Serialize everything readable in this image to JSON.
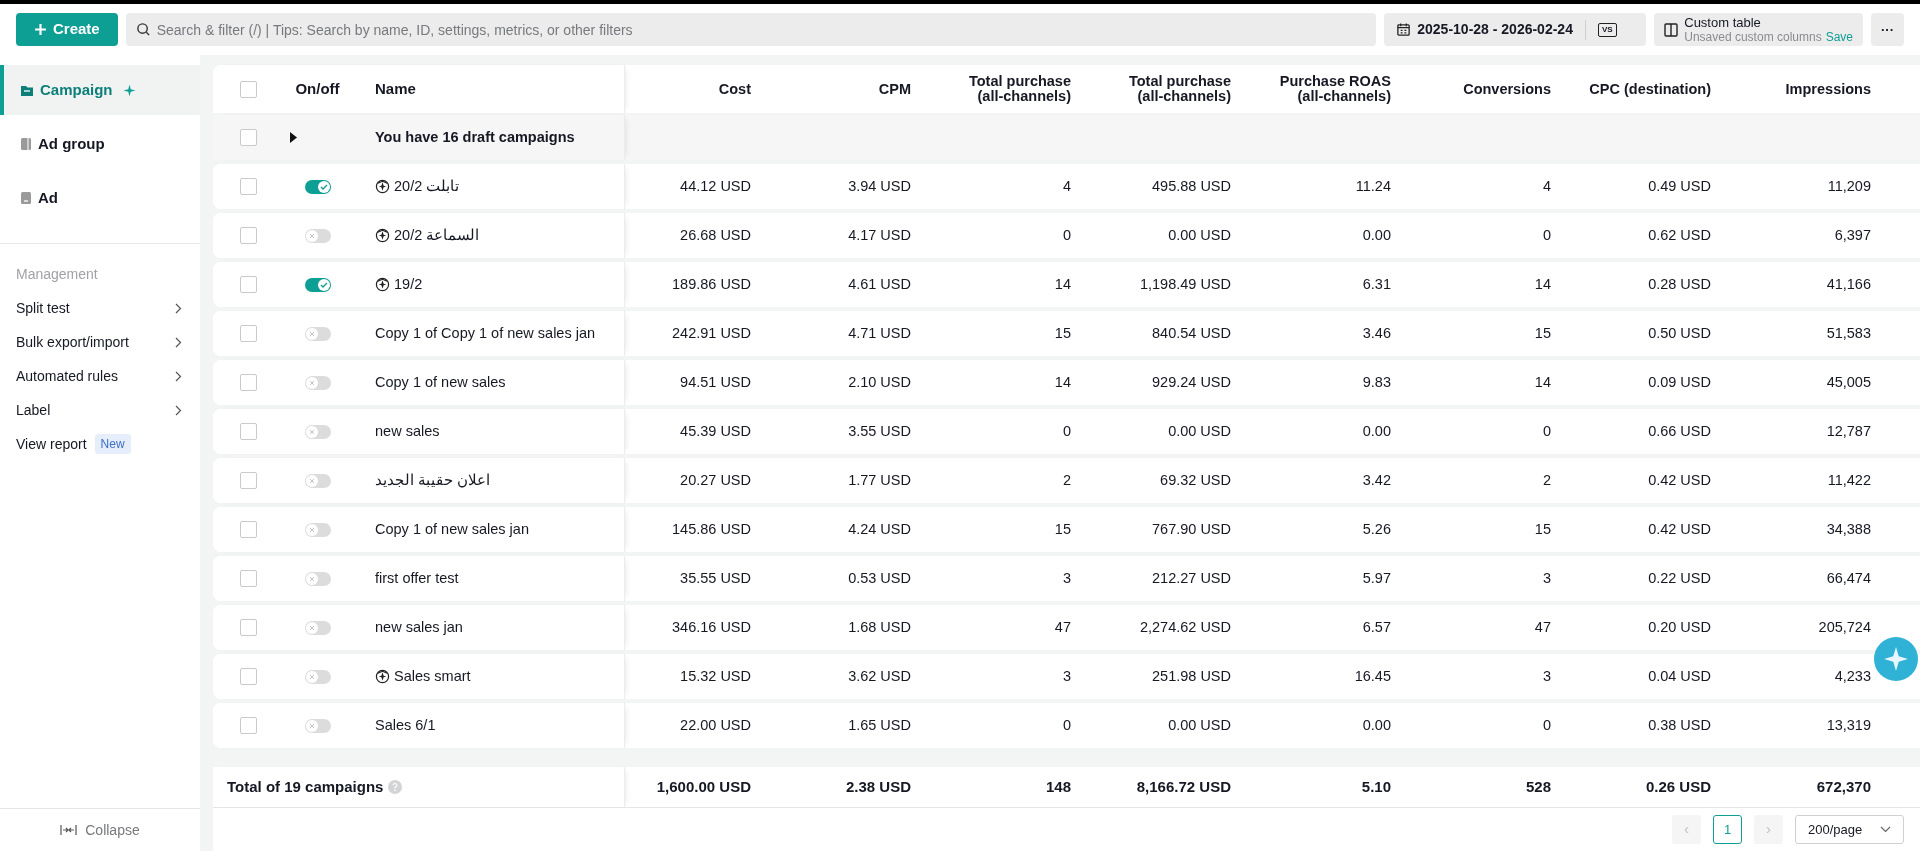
{
  "topbar": {
    "create": "Create",
    "search_placeholder": "Search & filter (/) | Tips: Search by name, ID, settings, metrics, or other filters",
    "date_range": "2025-10-28 - 2026-02-24",
    "compare": "VS",
    "custom_table": {
      "title": "Custom table",
      "subtitle": "Unsaved custom columns",
      "save": "Save"
    },
    "more": "···"
  },
  "sidebar": {
    "levels": [
      {
        "kind": "campaign",
        "label": "Campaign",
        "selected": true
      },
      {
        "kind": "adgroup",
        "label": "Ad group",
        "selected": false
      },
      {
        "kind": "ad",
        "label": "Ad",
        "selected": false
      }
    ],
    "management_title": "Management",
    "management_items": [
      {
        "kind": "submenu",
        "label": "Split test"
      },
      {
        "kind": "submenu",
        "label": "Bulk export/import"
      },
      {
        "kind": "submenu",
        "label": "Automated rules"
      },
      {
        "kind": "submenu",
        "label": "Label"
      },
      {
        "kind": "link",
        "label": "View report",
        "badge": "New"
      }
    ],
    "collapse": "Collapse"
  },
  "table": {
    "header_checked": false,
    "columns": [
      "On/off",
      "Name",
      "Cost",
      "CPM",
      "Total purchase\n(all-channels)",
      "Total purchase\n(all-channels)",
      "Purchase ROAS\n(all-channels)",
      "Conversions",
      "CPC (destination)",
      "Impressions"
    ],
    "draft_row": {
      "checked": false,
      "text": "You have 16 draft campaigns"
    },
    "rows": [
      {
        "checked": false,
        "on": true,
        "smart": true,
        "name": "تابلت 20/2",
        "values": [
          "44.12 USD",
          "3.94 USD",
          "4",
          "495.88 USD",
          "11.24",
          "4",
          "0.49 USD",
          "11,209"
        ]
      },
      {
        "checked": false,
        "on": false,
        "smart": true,
        "name": "السماعة 20/2",
        "values": [
          "26.68 USD",
          "4.17 USD",
          "0",
          "0.00 USD",
          "0.00",
          "0",
          "0.62 USD",
          "6,397"
        ]
      },
      {
        "checked": false,
        "on": true,
        "smart": true,
        "name": "19/2",
        "values": [
          "189.86 USD",
          "4.61 USD",
          "14",
          "1,198.49 USD",
          "6.31",
          "14",
          "0.28 USD",
          "41,166"
        ]
      },
      {
        "checked": false,
        "on": false,
        "smart": false,
        "name": "Copy 1 of Copy 1 of new sales jan",
        "values": [
          "242.91 USD",
          "4.71 USD",
          "15",
          "840.54 USD",
          "3.46",
          "15",
          "0.50 USD",
          "51,583"
        ]
      },
      {
        "checked": false,
        "on": false,
        "smart": false,
        "name": "Copy 1 of new sales",
        "values": [
          "94.51 USD",
          "2.10 USD",
          "14",
          "929.24 USD",
          "9.83",
          "14",
          "0.09 USD",
          "45,005"
        ]
      },
      {
        "checked": false,
        "on": false,
        "smart": false,
        "name": "new sales",
        "values": [
          "45.39 USD",
          "3.55 USD",
          "0",
          "0.00 USD",
          "0.00",
          "0",
          "0.66 USD",
          "12,787"
        ]
      },
      {
        "checked": false,
        "on": false,
        "smart": false,
        "name": "اعلان حقيبة الجديد",
        "values": [
          "20.27 USD",
          "1.77 USD",
          "2",
          "69.32 USD",
          "3.42",
          "2",
          "0.42 USD",
          "11,422"
        ]
      },
      {
        "checked": false,
        "on": false,
        "smart": false,
        "name": "Copy 1 of new sales jan",
        "values": [
          "145.86 USD",
          "4.24 USD",
          "15",
          "767.90 USD",
          "5.26",
          "15",
          "0.42 USD",
          "34,388"
        ]
      },
      {
        "checked": false,
        "on": false,
        "smart": false,
        "name": "first offer test",
        "values": [
          "35.55 USD",
          "0.53 USD",
          "3",
          "212.27 USD",
          "5.97",
          "3",
          "0.22 USD",
          "66,474"
        ]
      },
      {
        "checked": false,
        "on": false,
        "smart": false,
        "name": "new sales jan",
        "values": [
          "346.16 USD",
          "1.68 USD",
          "47",
          "2,274.62 USD",
          "6.57",
          "47",
          "0.20 USD",
          "205,724"
        ]
      },
      {
        "checked": false,
        "on": false,
        "smart": true,
        "name": "Sales smart",
        "values": [
          "15.32 USD",
          "3.62 USD",
          "3",
          "251.98 USD",
          "16.45",
          "3",
          "0.04 USD",
          "4,233"
        ]
      },
      {
        "checked": false,
        "on": false,
        "smart": false,
        "name": "Sales 6/1",
        "values": [
          "22.00 USD",
          "1.65 USD",
          "0",
          "0.00 USD",
          "0.00",
          "0",
          "0.38 USD",
          "13,319"
        ]
      }
    ],
    "total": {
      "label": "Total of 19 campaigns",
      "values": [
        "1,600.00 USD",
        "2.38 USD",
        "148",
        "8,166.72 USD",
        "5.10",
        "528",
        "0.26 USD",
        "672,370"
      ]
    }
  },
  "pagination": {
    "prev": "‹",
    "page": "1",
    "next": "›",
    "per_page": "200/page"
  }
}
